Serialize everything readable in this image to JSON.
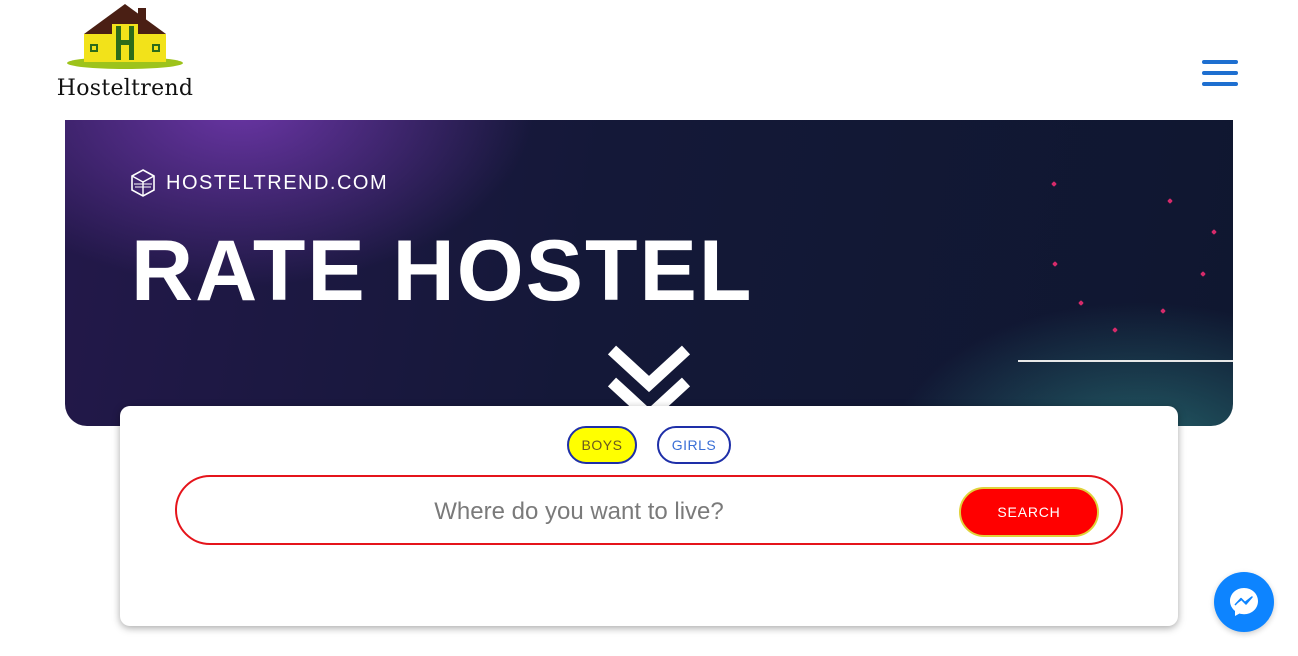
{
  "header": {
    "logo_text": "Hosteltrend",
    "logo_icon": "house-icon",
    "menu_icon": "hamburger-menu-icon"
  },
  "banner": {
    "brand_icon": "cube-icon",
    "brand_text": "HOSTELTREND.COM",
    "title": "RATE HOSTEL",
    "scroll_icon": "double-chevron-down-icon"
  },
  "search": {
    "tabs": [
      {
        "label": "BOYS",
        "active": true
      },
      {
        "label": "GIRLS",
        "active": false
      }
    ],
    "placeholder": "Where do you want to live?",
    "value": "",
    "button_label": "SEARCH"
  },
  "chat": {
    "icon": "messenger-icon"
  },
  "colors": {
    "accent_blue": "#1e6fd0",
    "search_red": "#ff0000",
    "boys_yellow": "#ffff00",
    "messenger_blue": "#0d84ff"
  }
}
